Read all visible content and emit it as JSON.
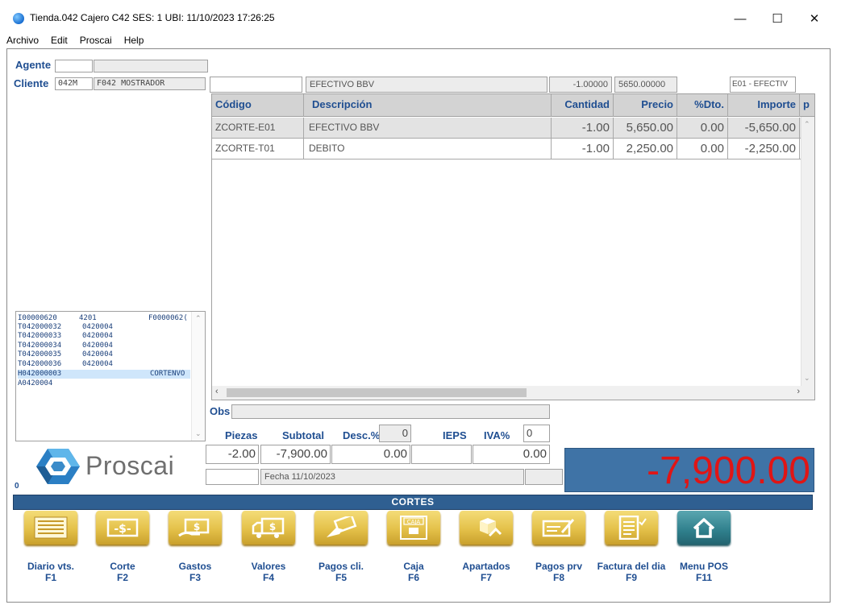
{
  "window": {
    "title": "Tienda.042  Cajero C42    SES: 1   UBI:    11/10/2023 17:26:25",
    "minimize": "—",
    "maximize": "☐",
    "close": "✕"
  },
  "menu": [
    "Archivo",
    "Edit",
    "Proscai",
    "Help"
  ],
  "form": {
    "agente_label": "Agente",
    "agente_value": "",
    "agente_name": "",
    "cliente_label": "Cliente",
    "cliente_code": "042M",
    "cliente_name": "F042 MOSTRADOR"
  },
  "topline": {
    "code": "",
    "desc": "EFECTIVO BBV",
    "cantidad": "-1.00000",
    "precio": "5650.00000",
    "account": "E01 - EFECTIV"
  },
  "grid": {
    "columns": [
      "Código",
      "Descripción",
      "Cantidad",
      "Precio",
      "%Dto.",
      "Importe",
      "p"
    ],
    "rows": [
      {
        "codigo": "ZCORTE-E01",
        "descripcion": "EFECTIVO BBV",
        "cantidad": "-1.00",
        "precio": "5,650.00",
        "dto": "0.00",
        "importe": "-5,650.00"
      },
      {
        "codigo": "ZCORTE-T01",
        "descripcion": "DEBITO",
        "cantidad": "-1.00",
        "precio": "2,250.00",
        "dto": "0.00",
        "importe": "-2,250.00"
      }
    ]
  },
  "list": [
    {
      "a": "I00000620",
      "b": "4201",
      "c": "F0000062(",
      "selected": false
    },
    {
      "a": "T042000032",
      "b": "0420004",
      "c": "",
      "selected": false
    },
    {
      "a": "T042000033",
      "b": "0420004",
      "c": "",
      "selected": false
    },
    {
      "a": "T042000034",
      "b": "0420004",
      "c": "",
      "selected": false
    },
    {
      "a": "T042000035",
      "b": "0420004",
      "c": "",
      "selected": false
    },
    {
      "a": "T042000036",
      "b": "0420004",
      "c": "",
      "selected": false
    },
    {
      "a": "H042000003",
      "b": "",
      "c": "CORTENVO",
      "selected": true
    },
    {
      "a": "A0420004",
      "b": "",
      "c": "",
      "selected": false
    }
  ],
  "obs_label": "Obs",
  "totals": {
    "piezas_label": "Piezas",
    "subtotal_label": "Subtotal",
    "desc_label": "Desc.%",
    "desc_pct": "0",
    "ieps_label": "IEPS",
    "iva_label": "IVA%",
    "iva_pct": "0",
    "piezas": "-2.00",
    "subtotal": "-7,900.00",
    "descuento": "0.00",
    "ieps": "",
    "iva": "0.00",
    "fecha": "Fecha 11/10/2023",
    "total": "-7,900.00"
  },
  "logo_text": "Proscai",
  "left_counter": "0",
  "section_title": "CORTES",
  "buttons": [
    {
      "label": "Diario vts.",
      "key": "F1",
      "icon": "journal-icon"
    },
    {
      "label": "Corte",
      "key": "F2",
      "icon": "cash-icon"
    },
    {
      "label": "Gastos",
      "key": "F3",
      "icon": "money-hand-icon"
    },
    {
      "label": "Valores",
      "key": "F4",
      "icon": "truck-icon"
    },
    {
      "label": "Pagos cli.",
      "key": "F5",
      "icon": "payment-icon"
    },
    {
      "label": "Caja",
      "key": "F6",
      "icon": "cashbox-icon"
    },
    {
      "label": "Apartados",
      "key": "F7",
      "icon": "package-icon"
    },
    {
      "label": "Pagos prv",
      "key": "F8",
      "icon": "check-sign-icon"
    },
    {
      "label": "Factura del dia",
      "key": "F9",
      "icon": "invoice-icon"
    },
    {
      "label": "Menu POS",
      "key": "F11",
      "icon": "home-icon"
    }
  ],
  "icon_text": {
    "cashbox": "CAJA"
  }
}
